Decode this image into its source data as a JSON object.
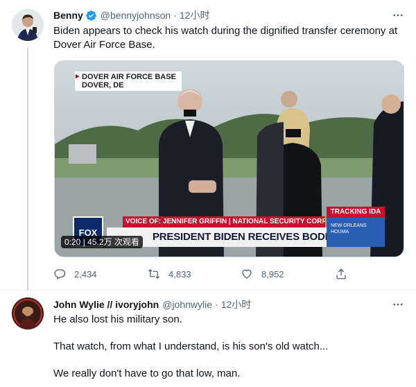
{
  "tweet1": {
    "author_name": "Benny",
    "author_handle": "@bennyjohnson",
    "time": "12小时",
    "text": "Biden appears to check his watch during the dignified transfer ceremony at Dover Air Force Base.",
    "media": {
      "location_line1": "DOVER AIR FORCE BASE",
      "location_line2": "DOVER, DE",
      "network_logo": "FOX",
      "chyron_top": "VOICE OF: JENNIFER GRIFFIN | NATIONAL SECURITY CORRESPONDENT",
      "chyron_main": "PRESIDENT BIDEN RECEIVES BODIES OF FALLEN TROOPS",
      "tracking_title": "TRACKING IDA",
      "tracking_map_label": "NEW ORLEANS HOUMA",
      "video_meta": "0:20 | 45.2万 次观看"
    },
    "stats": {
      "replies": "2,434",
      "retweets": "4,833",
      "likes": "8,952"
    }
  },
  "tweet2": {
    "author_name": "John Wylie // ivoryjohn",
    "author_handle": "@johnwylie",
    "time": "12小时",
    "paragraphs": [
      "He also lost his military son.",
      "That watch, from what I understand, is his son's old watch...",
      "We really don't have to go that low, man."
    ]
  },
  "separator": "·",
  "colors": {
    "verified_blue": "#1d9bf0",
    "secondary_text": "#536471",
    "thread_line": "#cfd9de"
  },
  "icons": [
    "verified-badge-icon",
    "more-icon",
    "reply-icon",
    "retweet-icon",
    "like-icon",
    "share-icon"
  ]
}
